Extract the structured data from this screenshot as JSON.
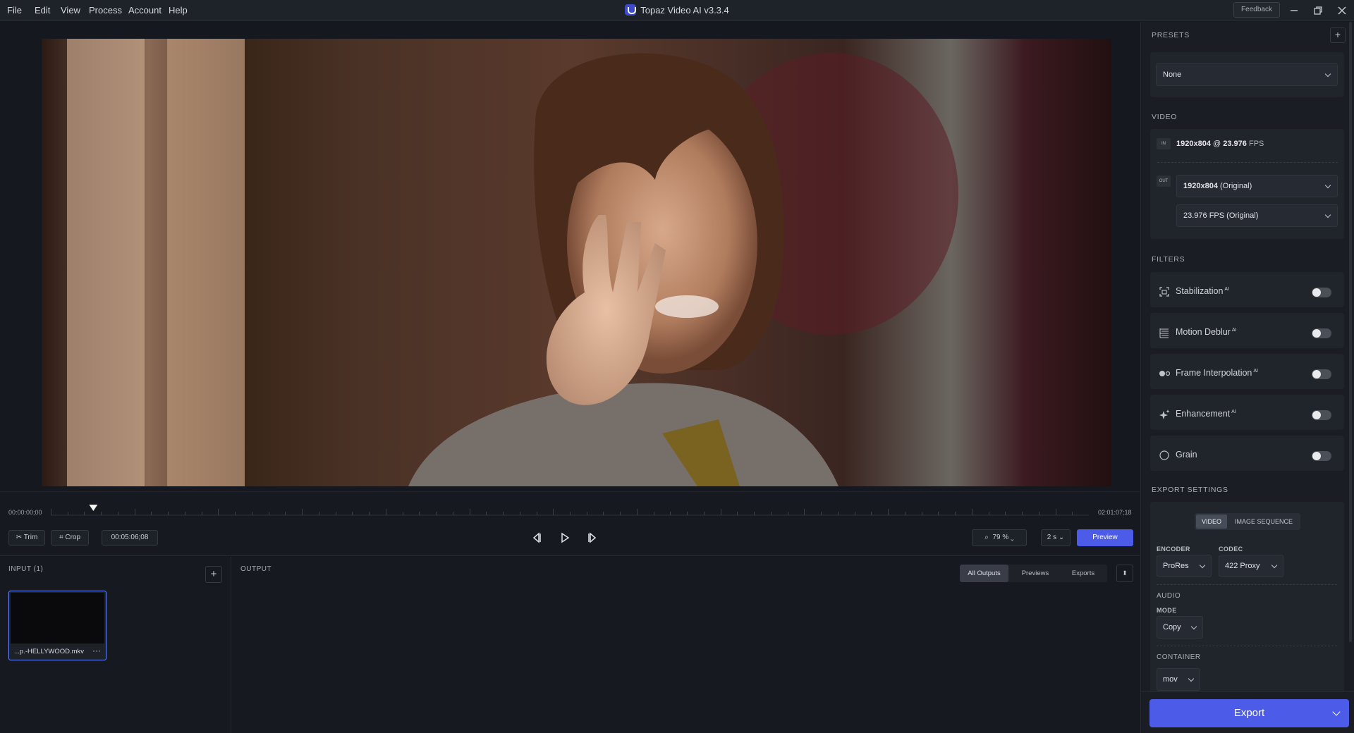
{
  "menu": {
    "file": "File",
    "edit": "Edit",
    "view": "View",
    "process": "Process",
    "account": "Account",
    "help": "Help"
  },
  "app": {
    "title": "Topaz Video AI  v3.3.4",
    "feedback": "Feedback"
  },
  "timeline": {
    "start": "00:00:00;00",
    "end": "02:01:07;18",
    "playhead_fraction": 0.041
  },
  "controls": {
    "trim": "Trim",
    "crop": "Crop",
    "current_time": "00:05:06;08",
    "zoom": "79 %",
    "speed": "2 s",
    "preview": "Preview"
  },
  "input": {
    "header": "INPUT (1)",
    "file_name": "...p.-HELLYWOOD.mkv"
  },
  "output": {
    "header": "OUTPUT",
    "tabs": [
      "All Outputs",
      "Previews",
      "Exports"
    ]
  },
  "presets": {
    "header": "PRESETS",
    "selected": "None"
  },
  "video": {
    "header": "VIDEO",
    "in_badge": "IN",
    "out_badge": "OUT",
    "in_resolution": "1920x804",
    "in_at": "@",
    "in_fps": "23.976",
    "in_fps_unit": "FPS",
    "out_resolution": "1920x804",
    "out_resolution_suffix": "(Original)",
    "out_fps": "23.976 FPS (Original)"
  },
  "filters": {
    "header": "FILTERS",
    "items": [
      {
        "label": "Stabilization",
        "ai": "AI",
        "enabled": false
      },
      {
        "label": "Motion Deblur",
        "ai": "AI",
        "enabled": false
      },
      {
        "label": "Frame Interpolation",
        "ai": "AI",
        "enabled": false
      },
      {
        "label": "Enhancement",
        "ai": "AI",
        "enabled": false
      },
      {
        "label": "Grain",
        "ai": "",
        "enabled": false
      }
    ]
  },
  "export_settings": {
    "header": "EXPORT SETTINGS",
    "tabs": [
      "VIDEO",
      "IMAGE SEQUENCE"
    ],
    "encoder_label": "ENCODER",
    "encoder": "ProRes",
    "codec_label": "CODEC",
    "codec": "422 Proxy",
    "audio_label": "AUDIO",
    "mode_label": "MODE",
    "mode": "Copy",
    "container_label": "CONTAINER",
    "container": "mov",
    "export": "Export"
  },
  "colors": {
    "accent": "#4d5ce8",
    "background": "#161920",
    "panel": "#1a1d23"
  }
}
